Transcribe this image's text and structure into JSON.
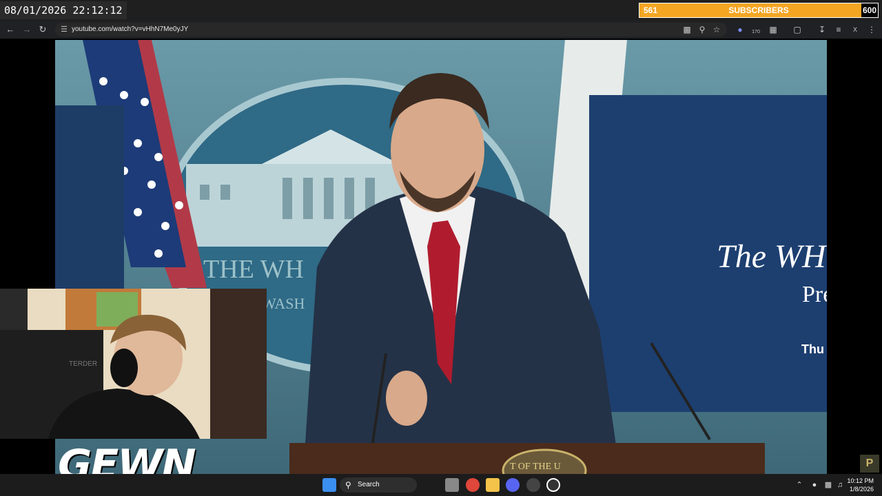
{
  "overlay": {
    "timestamp": "08/01/2026 22:12:12",
    "subscribers": {
      "current": "561",
      "label": "SUBSCRIBERS",
      "goal": "600",
      "progress": 0.935,
      "bar_color": "#f4a623"
    },
    "channel_logo_text": "GEWN"
  },
  "browser": {
    "url": "youtube.com/watch?v=vHhN7Me0yJY",
    "extensions_badge": "170",
    "profile_initial": "X"
  },
  "video": {
    "backdrop_text_1": "THE WH",
    "backdrop_text_2": "WASH",
    "screen_title_1": "The WH",
    "screen_title_2": "Pre",
    "screen_date": "Thu",
    "podium_text": "T OF THE U"
  },
  "webcam": {
    "chair_text": "TERDER"
  },
  "taskbar": {
    "search_label": "Search",
    "time": "10:12 PM",
    "date": "1/8/2026"
  },
  "corner_logo": "P"
}
